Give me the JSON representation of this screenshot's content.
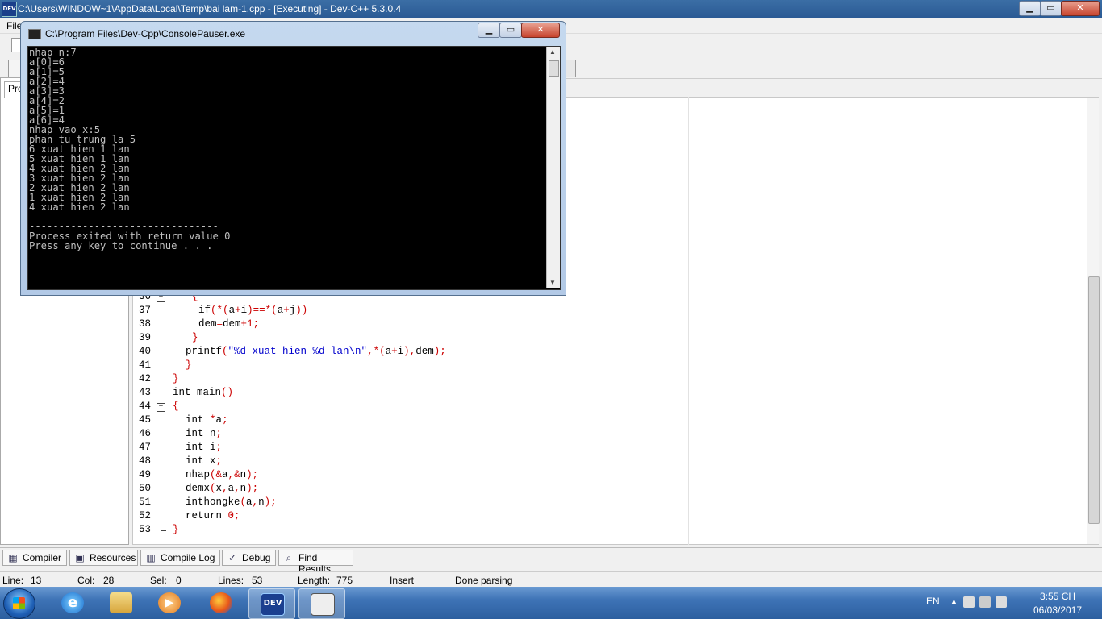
{
  "main_window": {
    "title": "C:\\Users\\WINDOW~1\\AppData\\Local\\Temp\\bai lam-1.cpp - [Executing] - Dev-C++ 5.3.0.4",
    "app_icon_text": "DEV",
    "btn_min": "▁",
    "btn_max": "▭",
    "btn_close": "✕"
  },
  "menu": {
    "file_label": "File"
  },
  "project_panel": {
    "tab_label": "Pro"
  },
  "editor": {
    "lines": [
      {
        "num": "36",
        "code": "{"
      },
      {
        "num": "37",
        "code": "if(*(a+i)==*(a+j))"
      },
      {
        "num": "38",
        "code": "dem=dem+1;"
      },
      {
        "num": "39",
        "code": "}"
      },
      {
        "num": "40",
        "code": "printf(\"%d xuat hien %d lan\\n\",*(a+i),dem);"
      },
      {
        "num": "41",
        "code": "}"
      },
      {
        "num": "42",
        "code": "}"
      },
      {
        "num": "43",
        "code": "int main()"
      },
      {
        "num": "44",
        "code": "{"
      },
      {
        "num": "45",
        "code": "int *a;"
      },
      {
        "num": "46",
        "code": "int n;"
      },
      {
        "num": "47",
        "code": "int i;"
      },
      {
        "num": "48",
        "code": "int x;"
      },
      {
        "num": "49",
        "code": "nhap(&a,&n);"
      },
      {
        "num": "50",
        "code": "demx(x,a,n);"
      },
      {
        "num": "51",
        "code": "inthongke(a,n);"
      },
      {
        "num": "52",
        "code": "return 0;"
      },
      {
        "num": "53",
        "code": "}"
      }
    ],
    "fold_minus": "−"
  },
  "bottom_tabs": [
    {
      "label": "Compiler",
      "icon": "grid-icon"
    },
    {
      "label": "Resources",
      "icon": "resources-icon"
    },
    {
      "label": "Compile Log",
      "icon": "chart-icon"
    },
    {
      "label": "Debug",
      "icon": "check-icon"
    },
    {
      "label": "Find Results",
      "icon": "find-icon"
    }
  ],
  "status": {
    "line_label": "Line:",
    "line_value": "13",
    "col_label": "Col:",
    "col_value": "28",
    "sel_label": "Sel:",
    "sel_value": "0",
    "lines_label": "Lines:",
    "lines_value": "53",
    "length_label": "Length:",
    "length_value": "775",
    "mode": "Insert",
    "message": "Done parsing"
  },
  "console": {
    "title": "C:\\Program Files\\Dev-Cpp\\ConsolePauser.exe",
    "output": "nhap n:7\na[0]=6\na[1]=5\na[2]=4\na[3]=3\na[4]=2\na[5]=1\na[6]=4\nnhap vao x:5\nphan tu trung la 5\n6 xuat hien 1 lan\n5 xuat hien 1 lan\n4 xuat hien 2 lan\n3 xuat hien 2 lan\n2 xuat hien 2 lan\n1 xuat hien 2 lan\n4 xuat hien 2 lan\n\n--------------------------------\nProcess exited with return value 0\nPress any key to continue . . .",
    "btn_min": "▁",
    "btn_max": "▭",
    "btn_close": "✕",
    "scroll_up": "▲",
    "scroll_down": "▼"
  },
  "taskbar": {
    "lang": "EN",
    "time": "3:55 CH",
    "date": "06/03/2017",
    "dev_label": "DEV",
    "tray_arrow": "▲"
  },
  "colors": {
    "keyword": "#000000",
    "symbol": "#cc0000",
    "string": "#0000cc"
  }
}
